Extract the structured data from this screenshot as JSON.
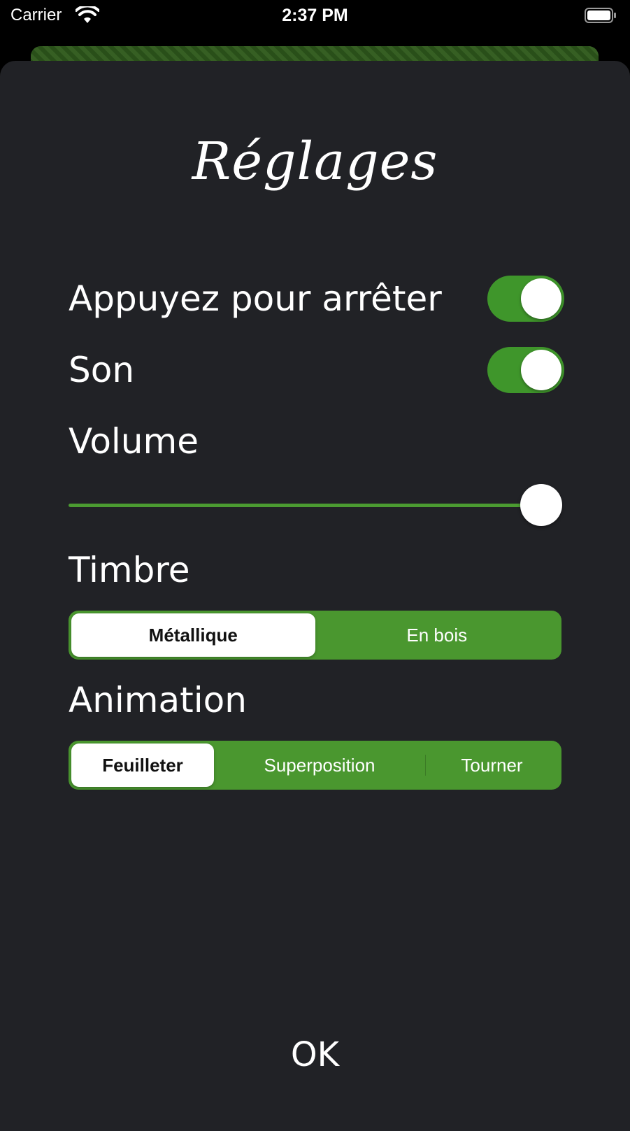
{
  "status_bar": {
    "carrier": "Carrier",
    "time": "2:37 PM",
    "icons": [
      "wifi-icon",
      "battery-icon"
    ]
  },
  "settings": {
    "title": "Réglages",
    "tap_to_stop": {
      "label": "Appuyez pour arrêter",
      "on": true
    },
    "sound": {
      "label": "Son",
      "on": true
    },
    "volume": {
      "label": "Volume",
      "level": 1.0
    },
    "timbre": {
      "label": "Timbre",
      "options": [
        "Métallique",
        "En bois"
      ],
      "selected": "Métallique"
    },
    "animation": {
      "label": "Animation",
      "options": [
        "Feuilleter",
        "Superposition",
        "Tourner"
      ],
      "selected": "Feuilleter"
    },
    "ok_label": "OK"
  },
  "colors": {
    "accent": "#3f962b",
    "sheet_background": "#212226",
    "text": "#ffffff"
  }
}
